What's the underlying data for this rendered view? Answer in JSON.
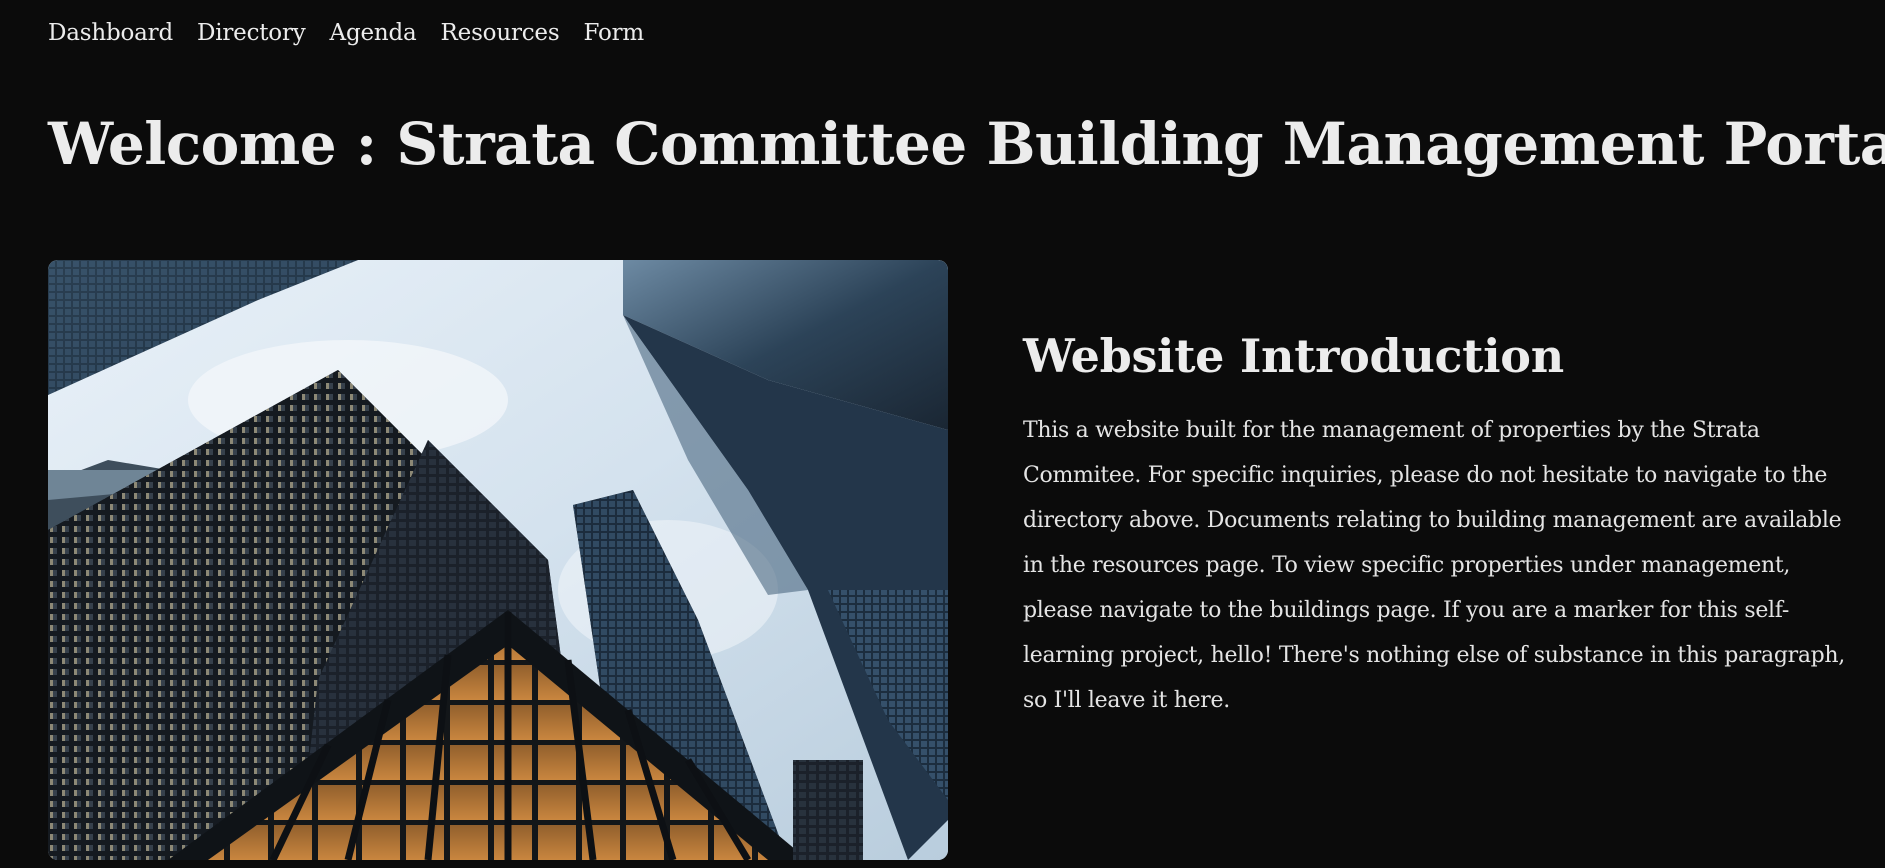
{
  "nav": {
    "items": [
      {
        "label": "Dashboard"
      },
      {
        "label": "Directory"
      },
      {
        "label": "Agenda"
      },
      {
        "label": "Resources"
      },
      {
        "label": "Form"
      }
    ]
  },
  "header": {
    "title": "Welcome : Strata Committee Building Management Portal"
  },
  "intro": {
    "heading": "Website Introduction",
    "body": "This a website built for the management of properties by the Strata Commitee. For specific inquiries, please do not hesitate to navigate to the directory above. Documents relating to building management are available in the resources page. To view specific properties under management, please navigate to the buildings page. If you are a marker for this self-learning project, hello! There's nothing else of substance in this paragraph, so I'll leave it here."
  },
  "colors": {
    "background": "#0b0b0b",
    "text": "#ececec"
  }
}
